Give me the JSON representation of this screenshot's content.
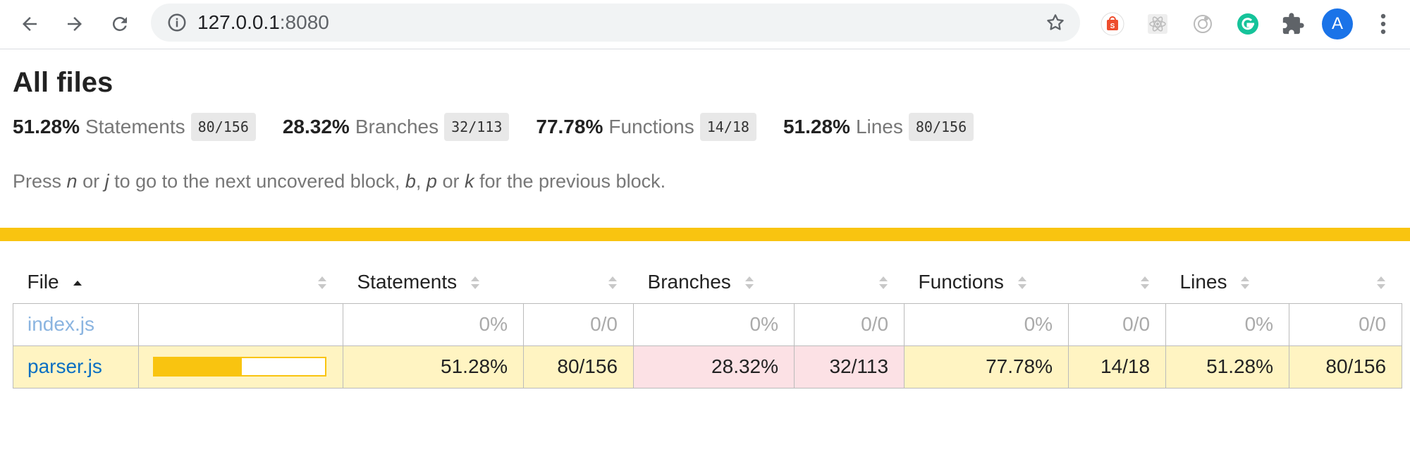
{
  "browser": {
    "url_host": "127.0.0.1",
    "url_port": ":8080",
    "avatar_letter": "A"
  },
  "page": {
    "title": "All files",
    "summary": [
      {
        "pct": "51.28%",
        "label": "Statements",
        "frac": "80/156"
      },
      {
        "pct": "28.32%",
        "label": "Branches",
        "frac": "32/113"
      },
      {
        "pct": "77.78%",
        "label": "Functions",
        "frac": "14/18"
      },
      {
        "pct": "51.28%",
        "label": "Lines",
        "frac": "80/156"
      }
    ],
    "hint": {
      "p1": "Press ",
      "k1": "n",
      "p2": " or ",
      "k2": "j",
      "p3": " to go to the next uncovered block, ",
      "k3": "b",
      "p4": ", ",
      "k4": "p",
      "p5": " or ",
      "k5": "k",
      "p6": " for the previous block."
    }
  },
  "table": {
    "headers": {
      "file": "File",
      "statements": "Statements",
      "branches": "Branches",
      "functions": "Functions",
      "lines": "Lines"
    },
    "rows": [
      {
        "file": "index.js",
        "coverage_fraction": 0,
        "statements_pct": "0%",
        "statements_frac": "0/0",
        "branches_pct": "0%",
        "branches_frac": "0/0",
        "functions_pct": "0%",
        "functions_frac": "0/0",
        "lines_pct": "0%",
        "lines_frac": "0/0"
      },
      {
        "file": "parser.js",
        "coverage_fraction": 0.5128,
        "statements_pct": "51.28%",
        "statements_frac": "80/156",
        "branches_pct": "28.32%",
        "branches_frac": "32/113",
        "functions_pct": "77.78%",
        "functions_frac": "14/18",
        "lines_pct": "51.28%",
        "lines_frac": "80/156"
      }
    ]
  },
  "colors": {
    "medium": "#fff4c2",
    "low": "#fce1e5",
    "accent_bar": "#f9c410",
    "link": "#0a6fc2"
  }
}
